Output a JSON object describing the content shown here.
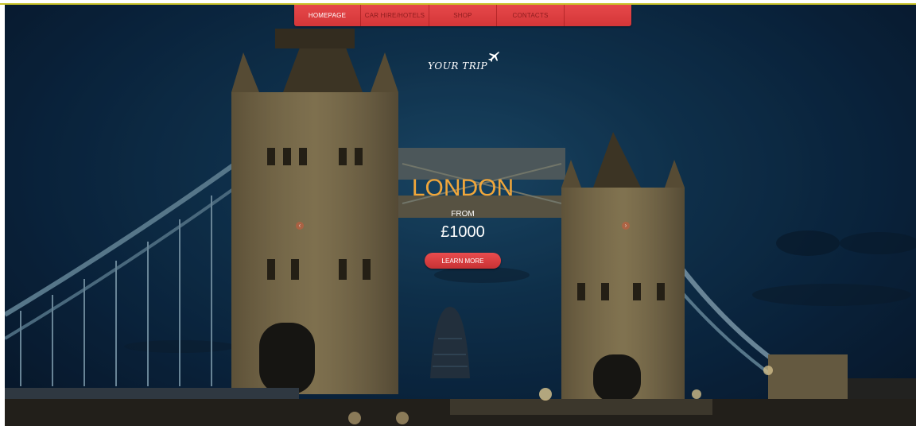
{
  "nav": {
    "items": [
      {
        "label": "HOMEPAGE",
        "active": true
      },
      {
        "label": "CAR HIRE/HOTELS",
        "active": false
      },
      {
        "label": "SHOP",
        "active": false
      },
      {
        "label": "CONTACTS",
        "active": false
      },
      {
        "label": "",
        "active": false
      }
    ]
  },
  "logo": {
    "text": "YOUR TRIP",
    "icon": "airplane-icon"
  },
  "promo": {
    "city": "LONDON",
    "from_label": "FROM",
    "price": "£1000",
    "cta_label": "LEARN MORE"
  },
  "slider": {
    "prev_icon": "chevron-left-icon",
    "next_icon": "chevron-right-icon"
  },
  "colors": {
    "nav_bg": "#e0403f",
    "accent_orange": "#f0a63a",
    "button_red": "#d83c3e",
    "sky": "#123a5a"
  }
}
